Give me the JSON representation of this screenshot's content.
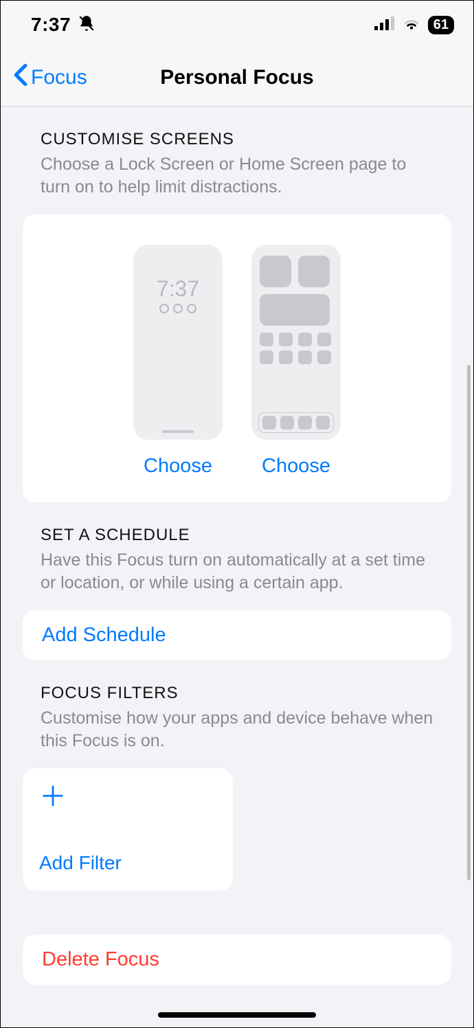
{
  "statusbar": {
    "time": "7:37",
    "battery": "61"
  },
  "nav": {
    "back": "Focus",
    "title": "Personal Focus"
  },
  "customise": {
    "title": "CUSTOMISE SCREENS",
    "desc": "Choose a Lock Screen or Home Screen page to turn on to help limit distractions.",
    "lock_time": "7:37",
    "choose_lock": "Choose",
    "choose_home": "Choose"
  },
  "schedule": {
    "title": "SET A SCHEDULE",
    "desc": "Have this Focus turn on automatically at a set time or location, or while using a certain app.",
    "add": "Add Schedule"
  },
  "filters": {
    "title": "FOCUS FILTERS",
    "desc": "Customise how your apps and device behave when this Focus is on.",
    "add": "Add Filter"
  },
  "delete": "Delete Focus"
}
